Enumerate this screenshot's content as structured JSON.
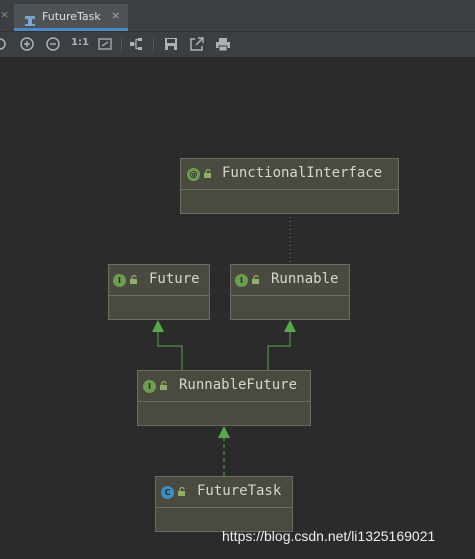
{
  "tab": {
    "title": "FutureTask",
    "close_glyph": "×",
    "prev_close_glyph": "×",
    "icon": "uml-diagram-icon"
  },
  "toolbar": {
    "items": [
      {
        "name": "zoom-in-icon"
      },
      {
        "name": "zoom-out-icon"
      },
      {
        "label": "1:1",
        "name": "actual-size-button"
      },
      {
        "name": "fit-content-icon"
      },
      {
        "name": "layout-icon"
      },
      {
        "name": "save-icon"
      },
      {
        "name": "export-icon"
      },
      {
        "name": "print-icon"
      }
    ]
  },
  "diagram": {
    "nodes": [
      {
        "id": "functional-interface",
        "title": "FunctionalInterface",
        "kind": "annotation",
        "badge": "@",
        "badge_color": "#6b9e4e"
      },
      {
        "id": "future",
        "title": "Future",
        "kind": "interface",
        "badge": "I",
        "badge_color": "#6b9e4e"
      },
      {
        "id": "runnable",
        "title": "Runnable",
        "kind": "interface",
        "badge": "I",
        "badge_color": "#6b9e4e"
      },
      {
        "id": "runnable-future",
        "title": "RunnableFuture",
        "kind": "interface",
        "badge": "I",
        "badge_color": "#6b9e4e"
      },
      {
        "id": "future-task",
        "title": "FutureTask",
        "kind": "class",
        "badge": "C",
        "badge_color": "#3d8ec2"
      }
    ],
    "edges": [
      {
        "from": "runnable-future",
        "to": "future",
        "type": "extends"
      },
      {
        "from": "runnable-future",
        "to": "runnable",
        "type": "extends"
      },
      {
        "from": "future-task",
        "to": "runnable-future",
        "type": "implements"
      },
      {
        "from": "runnable",
        "to": "functional-interface",
        "type": "annotated-by"
      }
    ]
  },
  "watermark": "https://blog.csdn.net/li1325169021",
  "colors": {
    "background": "#2b2b2b",
    "node_fill": "#4b4a41",
    "node_border": "#6e6d64",
    "edge": "#56a84a",
    "tab_underline": "#4a88c7"
  }
}
